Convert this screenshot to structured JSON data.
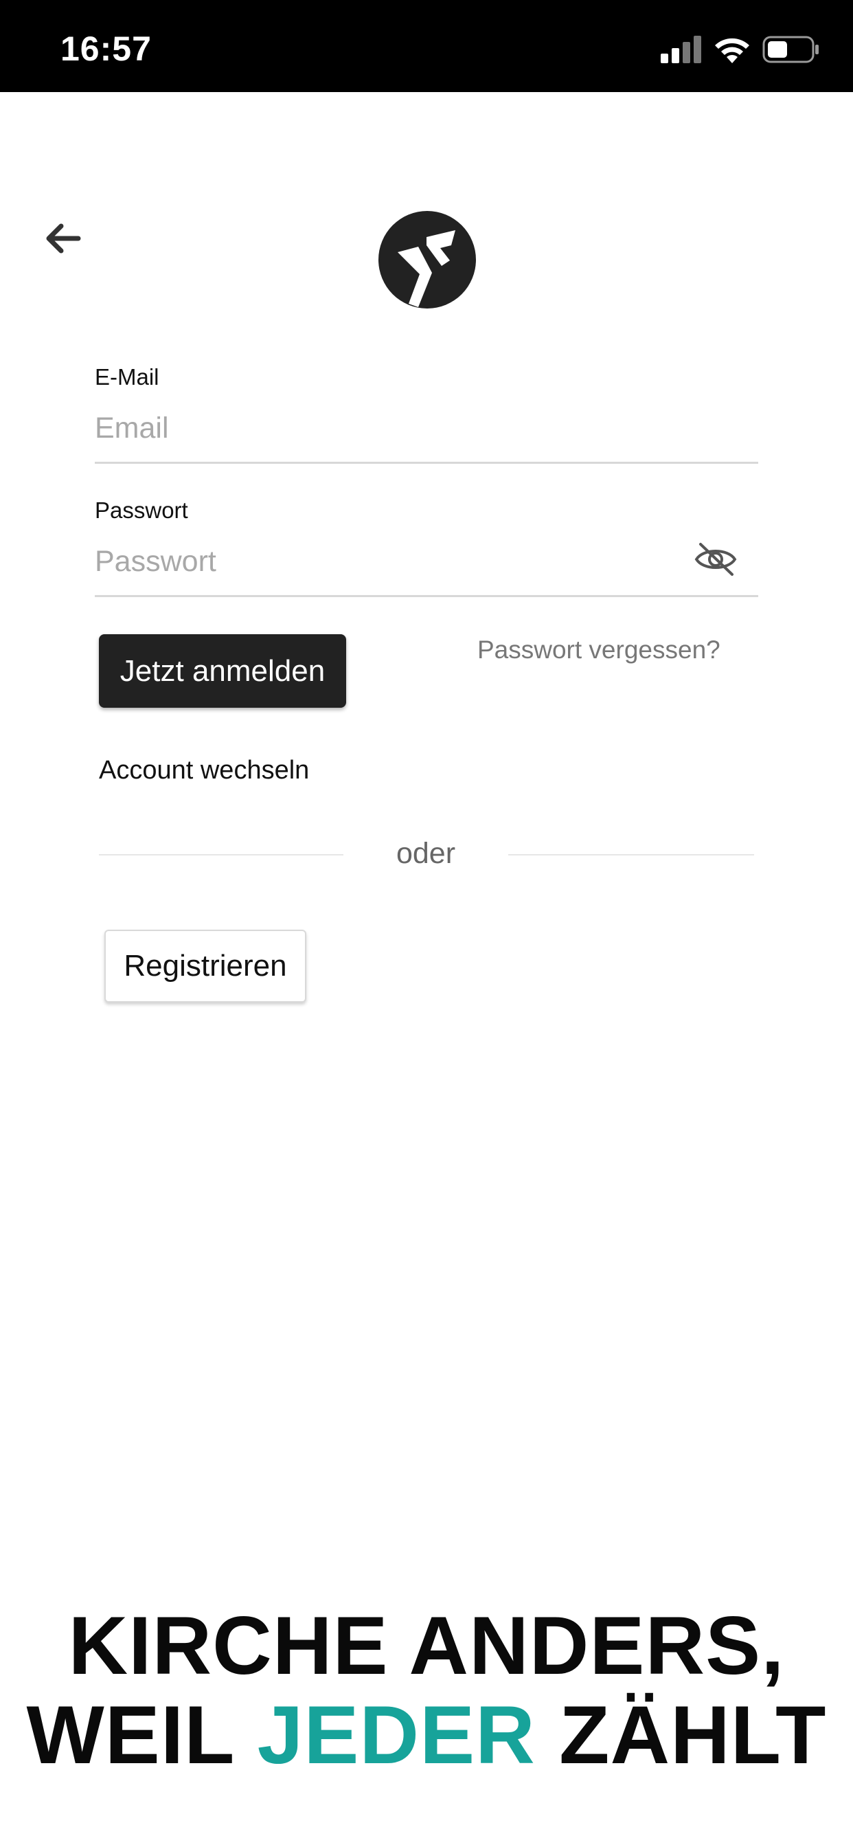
{
  "status_bar": {
    "time": "16:57",
    "icons": [
      "cellular-signal-icon",
      "wifi-icon",
      "battery-icon"
    ]
  },
  "header": {
    "back_icon": "back-arrow-icon",
    "logo_icon": "app-logo-icon"
  },
  "form": {
    "email": {
      "label": "E-Mail",
      "placeholder": "Email",
      "value": ""
    },
    "password": {
      "label": "Passwort",
      "placeholder": "Passwort",
      "value": "",
      "toggle_icon": "eye-slash-icon"
    },
    "login_label": "Jetzt anmelden",
    "forgot_label": "Passwort vergessen?",
    "switch_account_label": "Account wechseln",
    "divider_label": "oder",
    "register_label": "Registrieren"
  },
  "slogan": {
    "line1": "KIRCHE ANDERS,",
    "line2_before": "WEIL ",
    "line2_accent": "JEDER",
    "line2_after": " ZÄHLT"
  },
  "colors": {
    "accent": "#17a39a",
    "primary_button": "#222222",
    "status_bar": "#000000"
  }
}
